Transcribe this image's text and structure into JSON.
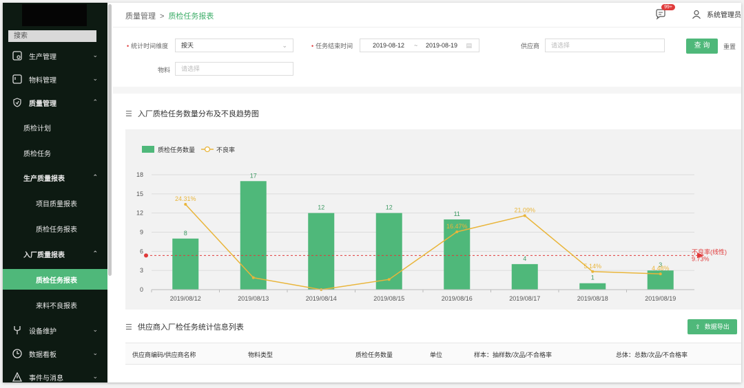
{
  "sidebar": {
    "search": "搜索",
    "items": [
      {
        "label": "生产管理",
        "icon": "production-icon"
      },
      {
        "label": "物料管理",
        "icon": "material-icon"
      },
      {
        "label": "质量管理",
        "icon": "shield-icon"
      },
      {
        "label": "质检计划"
      },
      {
        "label": "质检任务"
      },
      {
        "label": "生产质量报表"
      },
      {
        "label": "项目质量报表"
      },
      {
        "label": "质检任务报表"
      },
      {
        "label": "入厂质量报表"
      },
      {
        "label": "质检任务报表"
      },
      {
        "label": "来料不良报表"
      },
      {
        "label": "设备维护",
        "icon": "wrench-icon"
      },
      {
        "label": "数据看板",
        "icon": "dashboard-icon"
      },
      {
        "label": "事件与消息",
        "icon": "warning-icon"
      }
    ]
  },
  "header": {
    "breadcrumb_parent": "质量管理",
    "breadcrumb_sep": ">",
    "breadcrumb_current": "质检任务报表",
    "badge": "99+",
    "user": "系统管理员"
  },
  "filters": {
    "dim_label": "统计时间维度",
    "dim_value": "按天",
    "end_time_label": "任务结束时间",
    "start_date": "2019-08-12",
    "range_sep": "~",
    "end_date": "2019-08-19",
    "supplier_label": "供应商",
    "supplier_placeholder": "请选择",
    "material_label": "物料",
    "material_placeholder": "请选择",
    "query_button": "查 询",
    "reset_button": "重置"
  },
  "chart_section": {
    "title": "入厂质检任务数量分布及不良趋势图"
  },
  "chart_data": {
    "type": "bar",
    "categories": [
      "2019/08/12",
      "2019/08/13",
      "2019/08/14",
      "2019/08/15",
      "2019/08/16",
      "2019/08/17",
      "2019/08/18",
      "2019/08/19"
    ],
    "series": [
      {
        "name": "质检任务数量",
        "type": "bar",
        "values": [
          8,
          17,
          12,
          12,
          11,
          4,
          1,
          3
        ],
        "labels": [
          "8",
          "17",
          "12",
          "12",
          "11",
          "4",
          "1",
          "3"
        ]
      },
      {
        "name": "不良率",
        "type": "line",
        "values": [
          24.31,
          3.4,
          0,
          2.9,
          16.47,
          21.09,
          5.14,
          4.48
        ],
        "labels": [
          "24.31%",
          "",
          "",
          "",
          "16.47%",
          "21.09%",
          "5.14%",
          "4.48%"
        ]
      }
    ],
    "reference_line": {
      "name": "不良率(线性)",
      "value": 9.73,
      "label": "9.73%"
    },
    "yticks": [
      "0",
      "3",
      "6",
      "9",
      "12",
      "15",
      "18"
    ],
    "ylim": [
      0,
      18
    ],
    "grid": true,
    "legend": "top-left",
    "colors": {
      "bar": "#4fb87a",
      "line": "#e9b53a",
      "reference": "#e03a3a"
    }
  },
  "table_section": {
    "title": "供应商入厂检任务统计信息列表",
    "export_button": "数据导出",
    "headers": [
      "供应商编码/供应商名称",
      "物料类型",
      "质检任务数量",
      "单位",
      "样本：抽样数/次品/不合格率",
      "总体：总数/次品/不合格率"
    ]
  }
}
